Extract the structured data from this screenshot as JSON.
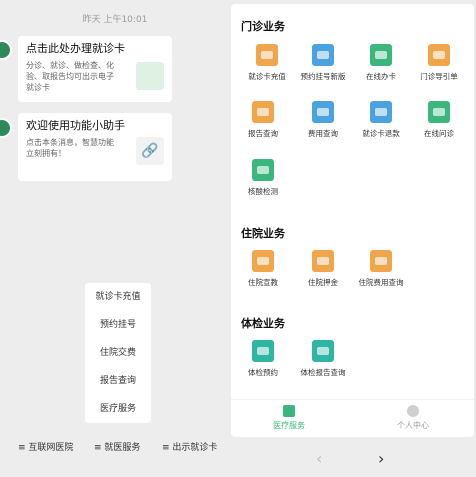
{
  "chat": {
    "timestamp": "昨天 上午10:01",
    "card1": {
      "title": "点击此处办理就诊卡",
      "desc": "分诊、就诊、做检查、化验、取报告均可出示电子就诊卡"
    },
    "card2": {
      "title": "欢迎使用功能小助手",
      "desc": "点击本条消息，智慧功能立刻拥有！"
    },
    "popup_menu": [
      "就诊卡充值",
      "预约挂号",
      "住院交费",
      "报告查询",
      "医疗服务"
    ],
    "bottom_tabs": [
      "互联网医院",
      "就医服务",
      "出示就诊卡"
    ]
  },
  "panel": {
    "outpatient": {
      "title": "门诊业务",
      "items": [
        {
          "label": "就诊卡充值",
          "icon": "wallet-card-icon",
          "color": "#f0a64a"
        },
        {
          "label": "预约挂号新版",
          "icon": "calendar-check-icon",
          "color": "#4aa3df"
        },
        {
          "label": "在线办卡",
          "icon": "card-icon",
          "color": "#3bb77e"
        },
        {
          "label": "门诊导引单",
          "icon": "guide-doc-icon",
          "color": "#f0a64a"
        },
        {
          "label": "报告查询",
          "icon": "report-icon",
          "color": "#f0a64a"
        },
        {
          "label": "费用查询",
          "icon": "fee-icon",
          "color": "#4aa3df"
        },
        {
          "label": "就诊卡退款",
          "icon": "refund-icon",
          "color": "#4aa3df"
        },
        {
          "label": "在线问诊",
          "icon": "consult-icon",
          "color": "#3bb77e"
        },
        {
          "label": "核酸检测",
          "icon": "test-bag-icon",
          "color": "#3bb77e"
        }
      ]
    },
    "inpatient": {
      "title": "住院业务",
      "items": [
        {
          "label": "住院宣教",
          "icon": "education-icon",
          "color": "#f0a64a"
        },
        {
          "label": "住院押金",
          "icon": "deposit-hand-icon",
          "color": "#f0a64a"
        },
        {
          "label": "住院费用查询",
          "icon": "fee-query-icon",
          "color": "#f0a64a"
        }
      ]
    },
    "checkup": {
      "title": "体检业务",
      "items": [
        {
          "label": "体检预约",
          "icon": "checkup-book-icon",
          "color": "#2fb5a3"
        },
        {
          "label": "体检报告查询",
          "icon": "checkup-report-icon",
          "color": "#2fb5a3"
        }
      ]
    },
    "tabbar": {
      "medical": "医疗服务",
      "personal": "个人中心",
      "active_color": "#3bb77e"
    }
  }
}
